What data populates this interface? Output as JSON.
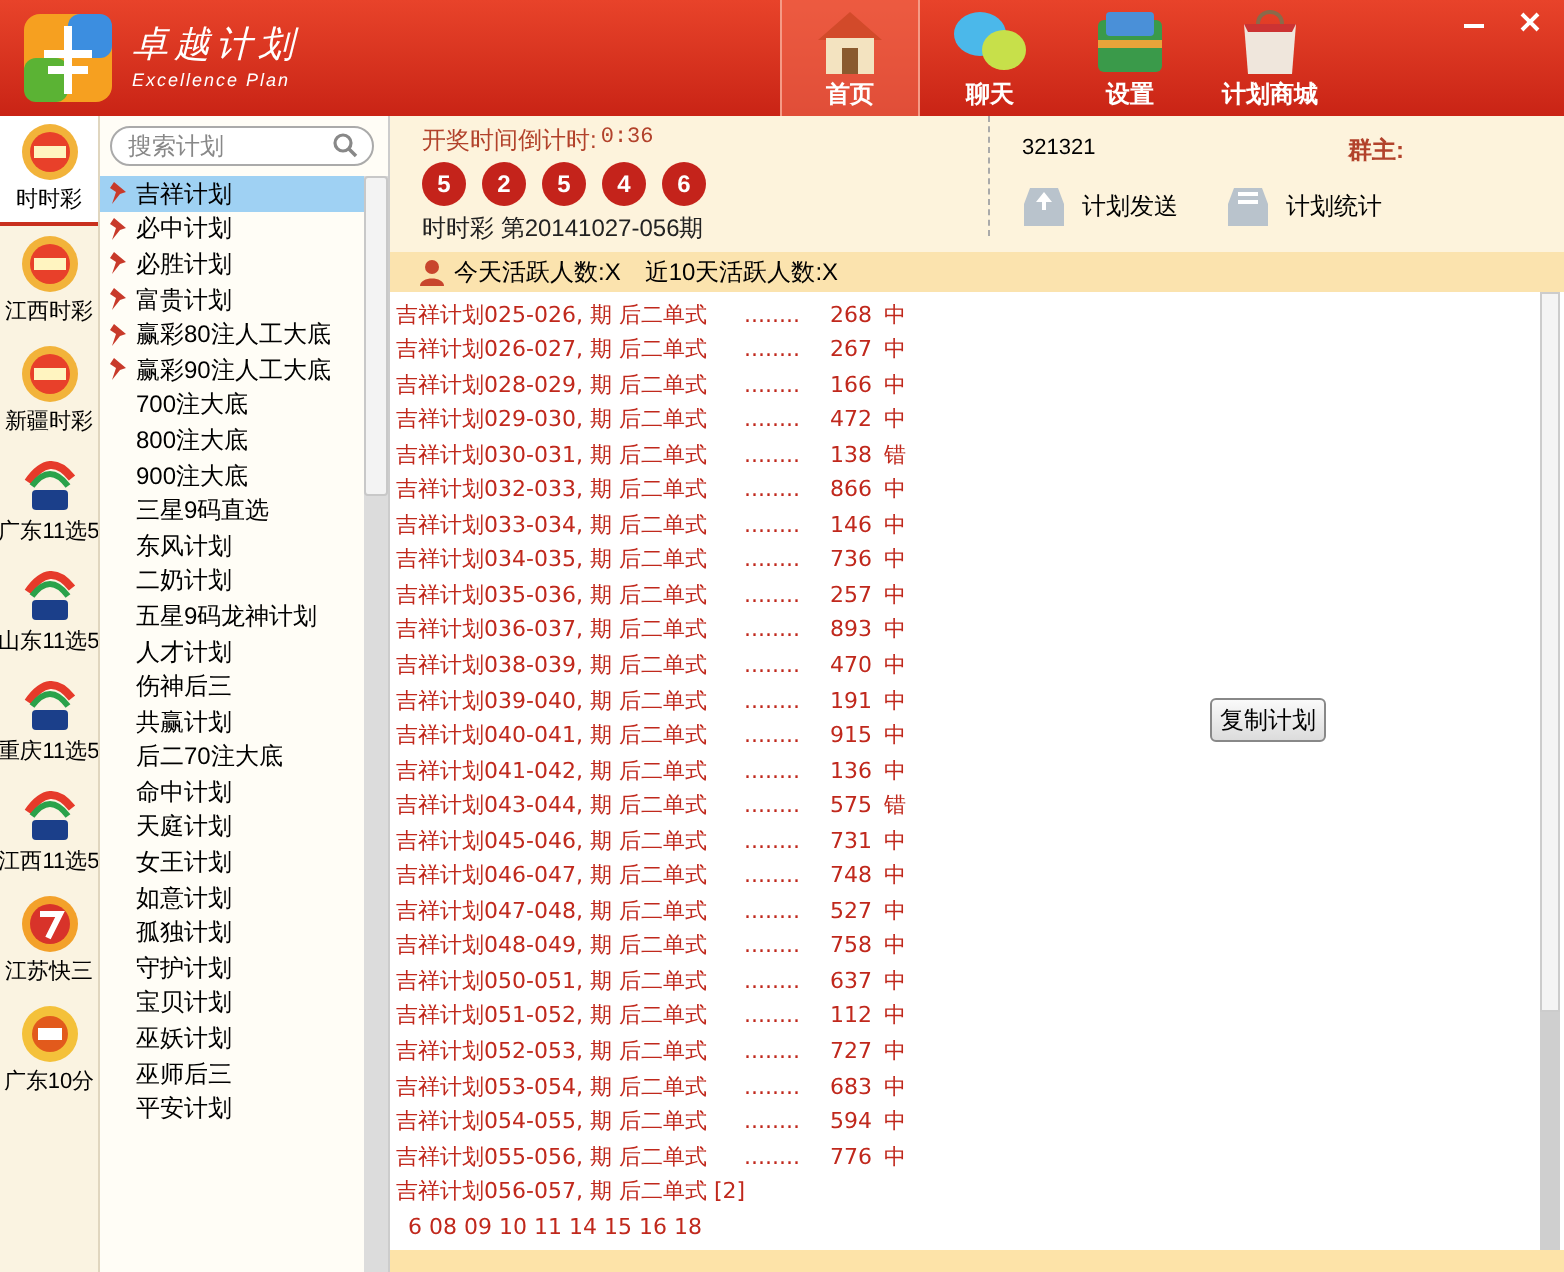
{
  "app": {
    "name": "卓越计划",
    "subtitle": "Excellence Plan"
  },
  "nav": [
    {
      "label": "首页",
      "selected": true,
      "kind": "house"
    },
    {
      "label": "聊天",
      "selected": false,
      "kind": "chat"
    },
    {
      "label": "设置",
      "selected": false,
      "kind": "settings"
    },
    {
      "label": "计划商城",
      "selected": false,
      "kind": "bag"
    }
  ],
  "lotteries": [
    {
      "label": "时时彩",
      "selected": true,
      "kind": "ssc"
    },
    {
      "label": "江西时彩",
      "selected": false,
      "kind": "ssc"
    },
    {
      "label": "新疆时彩",
      "selected": false,
      "kind": "ssc"
    },
    {
      "label": "广东11选5",
      "selected": false,
      "kind": "x5"
    },
    {
      "label": "山东11选5",
      "selected": false,
      "kind": "x5"
    },
    {
      "label": "重庆11选5",
      "selected": false,
      "kind": "x5"
    },
    {
      "label": "江西11选5",
      "selected": false,
      "kind": "x5"
    },
    {
      "label": "江苏快三",
      "selected": false,
      "kind": "k3"
    },
    {
      "label": "广东10分",
      "selected": false,
      "kind": "k10"
    }
  ],
  "search": {
    "placeholder": "搜索计划"
  },
  "plans": [
    {
      "label": "吉祥计划",
      "pinned": true,
      "selected": true
    },
    {
      "label": "必中计划",
      "pinned": true,
      "selected": false
    },
    {
      "label": "必胜计划",
      "pinned": true,
      "selected": false
    },
    {
      "label": "富贵计划",
      "pinned": true,
      "selected": false
    },
    {
      "label": "赢彩80注人工大底",
      "pinned": true,
      "selected": false
    },
    {
      "label": "赢彩90注人工大底",
      "pinned": true,
      "selected": false
    },
    {
      "label": "700注大底",
      "pinned": false,
      "selected": false
    },
    {
      "label": "800注大底",
      "pinned": false,
      "selected": false
    },
    {
      "label": "900注大底",
      "pinned": false,
      "selected": false
    },
    {
      "label": "三星9码直选",
      "pinned": false,
      "selected": false
    },
    {
      "label": "东风计划",
      "pinned": false,
      "selected": false
    },
    {
      "label": "二奶计划",
      "pinned": false,
      "selected": false
    },
    {
      "label": "五星9码龙神计划",
      "pinned": false,
      "selected": false
    },
    {
      "label": "人才计划",
      "pinned": false,
      "selected": false
    },
    {
      "label": "伤神后三",
      "pinned": false,
      "selected": false
    },
    {
      "label": "共赢计划",
      "pinned": false,
      "selected": false
    },
    {
      "label": "后二70注大底",
      "pinned": false,
      "selected": false
    },
    {
      "label": "命中计划",
      "pinned": false,
      "selected": false
    },
    {
      "label": "天庭计划",
      "pinned": false,
      "selected": false
    },
    {
      "label": "女王计划",
      "pinned": false,
      "selected": false
    },
    {
      "label": "如意计划",
      "pinned": false,
      "selected": false
    },
    {
      "label": "孤独计划",
      "pinned": false,
      "selected": false
    },
    {
      "label": "守护计划",
      "pinned": false,
      "selected": false
    },
    {
      "label": "宝贝计划",
      "pinned": false,
      "selected": false
    },
    {
      "label": "巫妖计划",
      "pinned": false,
      "selected": false
    },
    {
      "label": "巫师后三",
      "pinned": false,
      "selected": false
    },
    {
      "label": "平安计划",
      "pinned": false,
      "selected": false
    }
  ],
  "draw": {
    "countdown_label": "开奖时间倒计时:",
    "countdown": "0:36",
    "balls": [
      "5",
      "2",
      "5",
      "4",
      "6"
    ],
    "issue": "时时彩 第20141027-056期"
  },
  "group": {
    "id": "321321",
    "owner_label": "群主:",
    "actions": [
      {
        "label": "计划发送",
        "kind": "send"
      },
      {
        "label": "计划统计",
        "kind": "stats"
      }
    ]
  },
  "active": {
    "today": "今天活跃人数:X",
    "recent": "近10天活跃人数:X"
  },
  "log": [
    {
      "plan": "吉祥计划025-026, 期 后二单式",
      "dots": "........",
      "number": "268",
      "result": "中"
    },
    {
      "plan": "吉祥计划026-027, 期 后二单式",
      "dots": "........",
      "number": "267",
      "result": "中"
    },
    {
      "plan": "吉祥计划028-029, 期 后二单式",
      "dots": "........",
      "number": "166",
      "result": "中"
    },
    {
      "plan": "吉祥计划029-030, 期 后二单式",
      "dots": "........",
      "number": "472",
      "result": "中"
    },
    {
      "plan": "吉祥计划030-031, 期 后二单式",
      "dots": "........",
      "number": "138",
      "result": "错"
    },
    {
      "plan": "吉祥计划032-033, 期 后二单式",
      "dots": "........",
      "number": "866",
      "result": "中"
    },
    {
      "plan": "吉祥计划033-034, 期 后二单式",
      "dots": "........",
      "number": "146",
      "result": "中"
    },
    {
      "plan": "吉祥计划034-035, 期 后二单式",
      "dots": "........",
      "number": "736",
      "result": "中"
    },
    {
      "plan": "吉祥计划035-036, 期 后二单式",
      "dots": "........",
      "number": "257",
      "result": "中"
    },
    {
      "plan": "吉祥计划036-037, 期 后二单式",
      "dots": "........",
      "number": "893",
      "result": "中"
    },
    {
      "plan": "吉祥计划038-039, 期 后二单式",
      "dots": "........",
      "number": "470",
      "result": "中"
    },
    {
      "plan": "吉祥计划039-040, 期 后二单式",
      "dots": "........",
      "number": "191",
      "result": "中"
    },
    {
      "plan": "吉祥计划040-041, 期 后二单式",
      "dots": "........",
      "number": "915",
      "result": "中"
    },
    {
      "plan": "吉祥计划041-042, 期 后二单式",
      "dots": "........",
      "number": "136",
      "result": "中"
    },
    {
      "plan": "吉祥计划043-044, 期 后二单式",
      "dots": "........",
      "number": "575",
      "result": "错"
    },
    {
      "plan": "吉祥计划045-046, 期 后二单式",
      "dots": "........",
      "number": "731",
      "result": "中"
    },
    {
      "plan": "吉祥计划046-047, 期 后二单式",
      "dots": "........",
      "number": "748",
      "result": "中"
    },
    {
      "plan": "吉祥计划047-048, 期 后二单式",
      "dots": "........",
      "number": "527",
      "result": "中"
    },
    {
      "plan": "吉祥计划048-049, 期 后二单式",
      "dots": "........",
      "number": "758",
      "result": "中"
    },
    {
      "plan": "吉祥计划050-051, 期 后二单式",
      "dots": "........",
      "number": "637",
      "result": "中"
    },
    {
      "plan": "吉祥计划051-052, 期 后二单式",
      "dots": "........",
      "number": "112",
      "result": "中"
    },
    {
      "plan": "吉祥计划052-053, 期 后二单式",
      "dots": "........",
      "number": "727",
      "result": "中"
    },
    {
      "plan": "吉祥计划053-054, 期 后二单式",
      "dots": "........",
      "number": "683",
      "result": "中"
    },
    {
      "plan": "吉祥计划054-055, 期 后二单式",
      "dots": "........",
      "number": "594",
      "result": "中"
    },
    {
      "plan": "吉祥计划055-056, 期 后二单式",
      "dots": "........",
      "number": "776",
      "result": "中"
    },
    {
      "plan": "吉祥计划056-057, 期 后二单式 [2]"
    }
  ],
  "numbers_line": "6 08 09 10 11 14 15 16 18",
  "copy_button": "复制计划"
}
